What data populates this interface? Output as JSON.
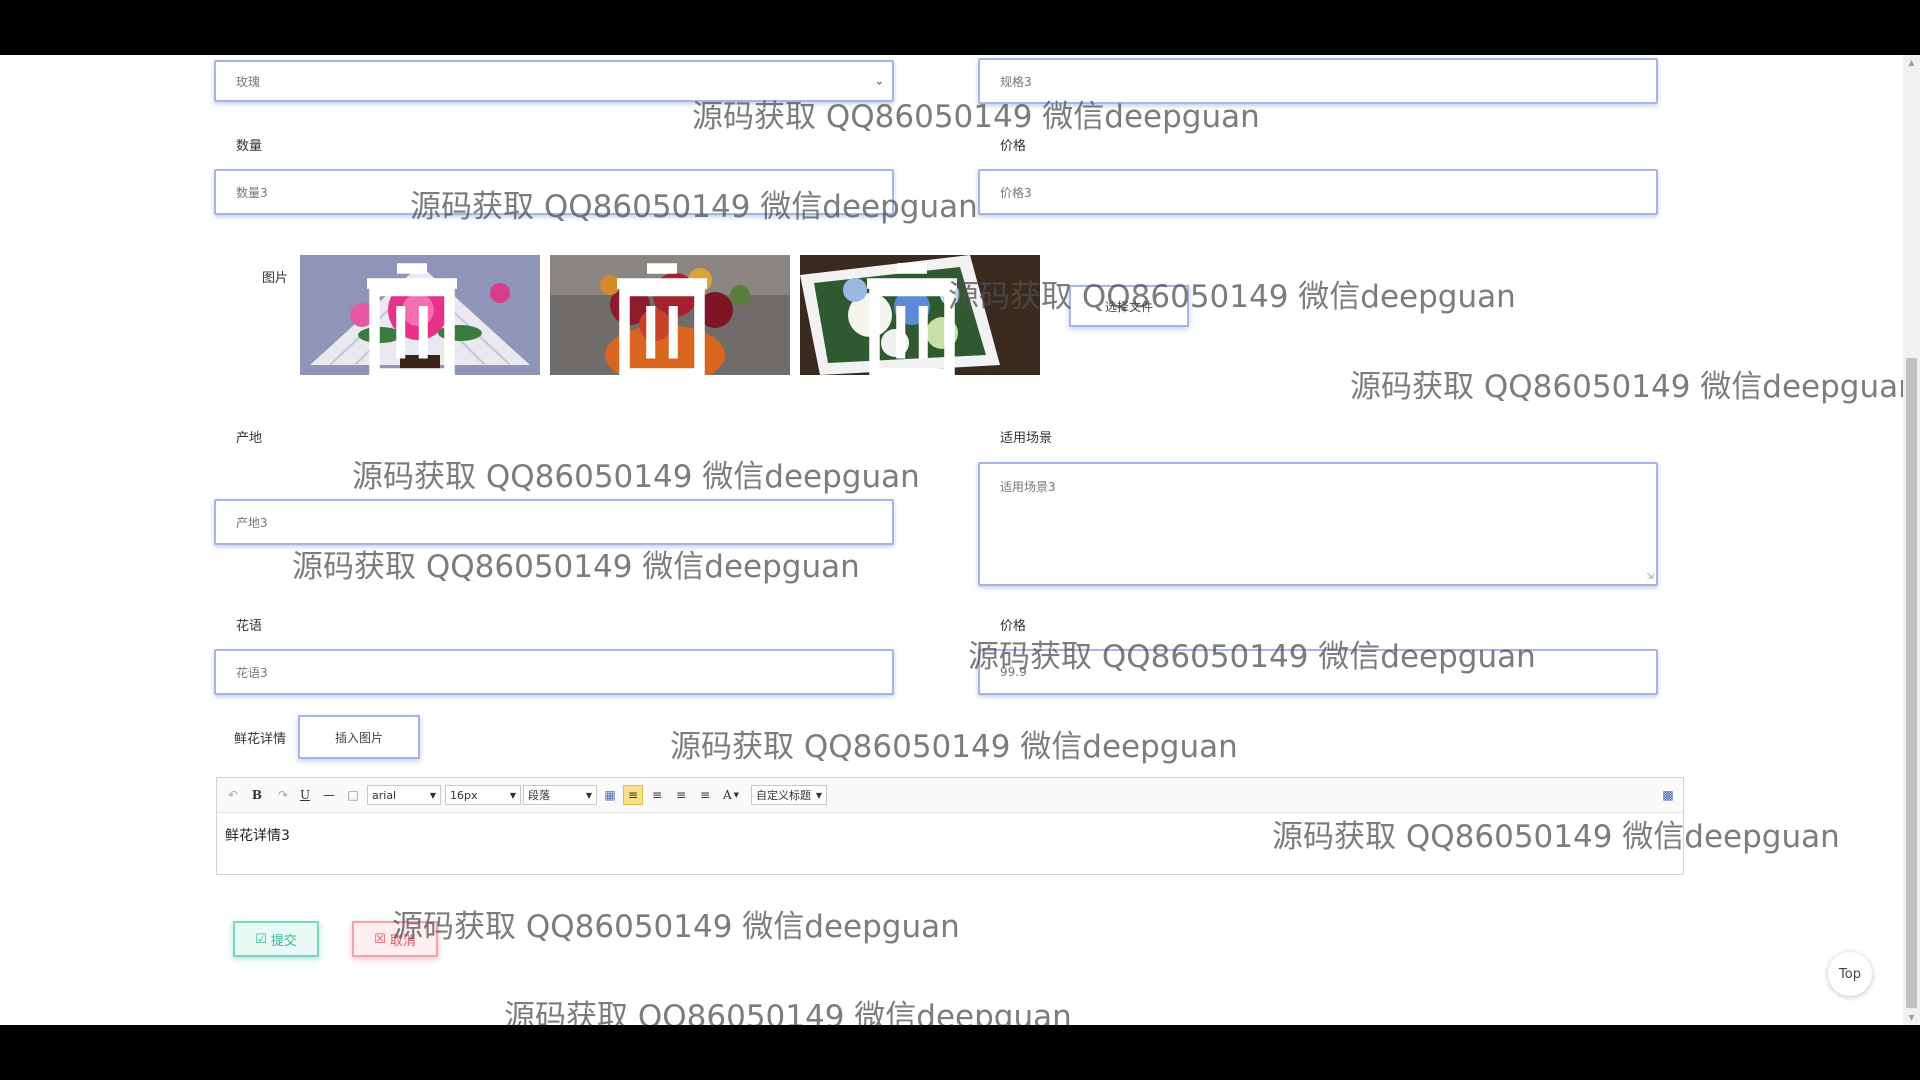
{
  "form": {
    "category_select": {
      "value": "玫瑰"
    },
    "spec_field": {
      "value": "规格3"
    },
    "quantity": {
      "label": "数量",
      "value": "数量3"
    },
    "price": {
      "label": "价格",
      "value": "价格3"
    },
    "images": {
      "label": "图片",
      "choose_file_label": "选择文件"
    },
    "origin": {
      "label": "产地",
      "value": "产地3"
    },
    "scene": {
      "label": "适用场景",
      "value": "适用场景3"
    },
    "flower_language": {
      "label": "花语",
      "value": "花语3"
    },
    "price2": {
      "label": "价格",
      "value": "99.9"
    },
    "details": {
      "label": "鲜花详情",
      "insert_image_label": "插入图片"
    }
  },
  "editor": {
    "font_family": "arial",
    "font_size": "16px",
    "paragraph": "段落",
    "custom_title": "自定义标题",
    "content": "鲜花详情3"
  },
  "actions": {
    "submit_label": "提交",
    "cancel_label": "取消"
  },
  "top_button_label": "Top",
  "watermark_text": "源码获取 QQ86050149 微信deepguan"
}
